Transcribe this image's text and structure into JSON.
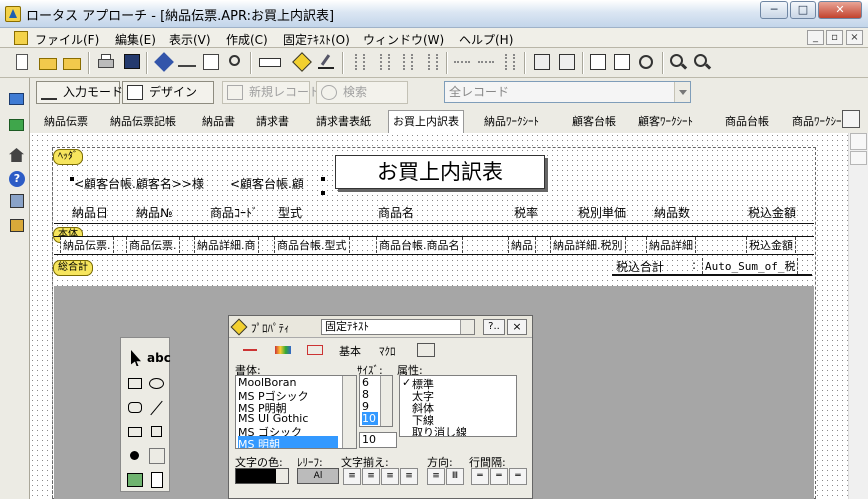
{
  "window": {
    "title": "ロータス アプローチ - [納品伝票.APR:お買上内訳表]"
  },
  "menu": [
    {
      "label": "ファイル(F)"
    },
    {
      "label": "編集(E)"
    },
    {
      "label": "表示(V)"
    },
    {
      "label": "作成(C)"
    },
    {
      "label": "固定ﾃｷｽﾄ(O)"
    },
    {
      "label": "ウィンドウ(W)"
    },
    {
      "label": "ヘルプ(H)"
    }
  ],
  "modebar": {
    "input_mode": "入力モード",
    "design": "デザイン",
    "new_record": "新規レコード",
    "search": "検索",
    "record_filter": "全レコード"
  },
  "tabs": [
    {
      "label": "納品伝票"
    },
    {
      "label": "納品伝票記帳"
    },
    {
      "label": "納品書"
    },
    {
      "label": "請求書"
    },
    {
      "label": "請求書表紙"
    },
    {
      "label": "お買上内訳表"
    },
    {
      "label": "納品ﾜｰｸｼｰﾄ"
    },
    {
      "label": "顧客台帳"
    },
    {
      "label": "顧客ﾜｰｸｼｰﾄ"
    },
    {
      "label": "商品台帳"
    },
    {
      "label": "商品ﾜｰｸｼｰﾄ"
    }
  ],
  "report": {
    "band_header": "ﾍｯﾀﾞ",
    "band_body": "本体",
    "band_total": "総合計",
    "customer_field": "<顧客台帳.顧客名>>様",
    "customer_field2": "<顧客台帳.顧",
    "title": "お買上内訳表",
    "columns": [
      "納品日",
      "納品№",
      "商品ｺｰﾄﾞ",
      "型式",
      "商品名",
      "税率",
      "税別単価",
      "納品数",
      "税込金額"
    ],
    "fields": [
      "納品伝票.",
      "商品伝票.",
      "納品詳細.商",
      "商品台帳.型式",
      "商品台帳.商品名",
      "納品",
      "納品詳細.税別",
      "納品詳細",
      "税込金額"
    ],
    "total_label": "税込合計",
    "total_colon": ":",
    "total_field": "Auto_Sum_of_税"
  },
  "properties": {
    "title": "ﾌﾟﾛﾊﾟﾃｨ",
    "object": "固定ﾃｷｽﾄ",
    "help": "?..",
    "close": "×",
    "tabs": [
      "基本",
      "ﾏｸﾛ"
    ],
    "font_label": "書体:",
    "size_label": "ｻｲｽﾞ:",
    "attr_label": "属性:",
    "fonts": [
      "MoolBoran",
      "MS Pゴシック",
      "MS P明朝",
      "MS UI Gothic",
      "MS ゴシック",
      "MS 明朝"
    ],
    "sizes": [
      "6",
      "8",
      "9",
      "10"
    ],
    "size_value": "10",
    "attributes": [
      "標準",
      "太字",
      "斜体",
      "下線",
      "取り消し線"
    ],
    "checkmark": "✓",
    "text_color_label": "文字の色:",
    "relief_label": "ﾚﾘｰﾌ:",
    "align_label": "文字揃え:",
    "direction_label": "方向:",
    "line_spacing_label": "行間隔:",
    "relief_sample": "Al"
  },
  "toolpal": {
    "text_tool": "abc"
  },
  "colors": {
    "band": "#f6e55d",
    "selection": "#3399ff",
    "gray_area": "#a6a6a6"
  }
}
